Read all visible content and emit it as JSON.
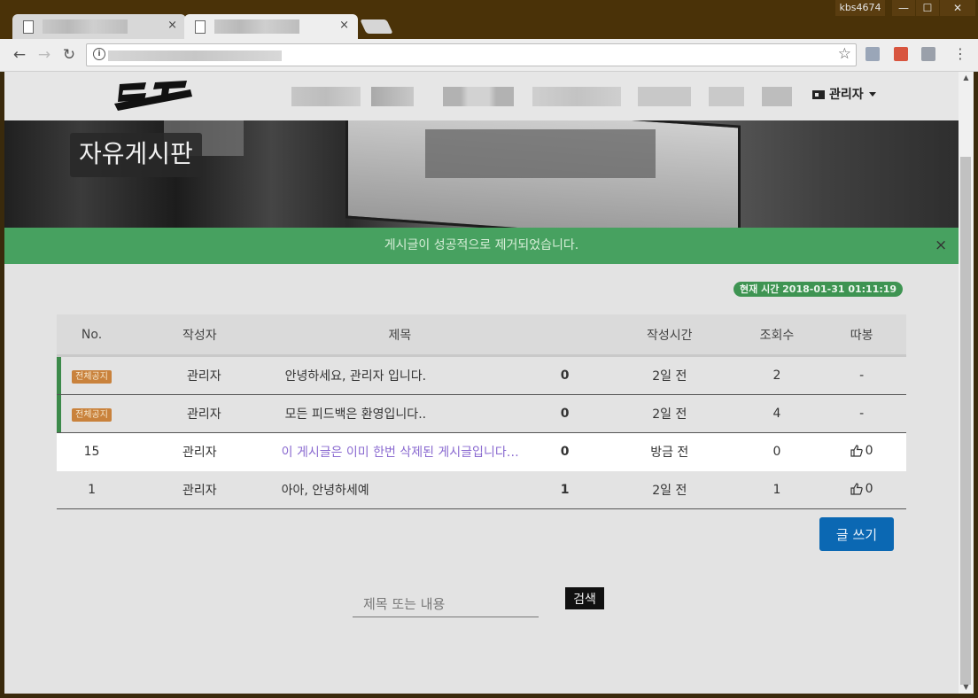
{
  "window": {
    "user": "kbs4674",
    "buttons": {
      "minimize": "—",
      "maximize": "☐",
      "close": "✕"
    }
  },
  "tabs": [
    {
      "close": "×"
    },
    {
      "close": "×"
    }
  ],
  "toolbar": {
    "back": "←",
    "forward": "→",
    "reload": "↻",
    "info": "i",
    "star": "☆",
    "menu": "⋮"
  },
  "header": {
    "logo_text": "로고",
    "admin_label": "관리자"
  },
  "hero": {
    "title": "자유게시판"
  },
  "alert": {
    "message": "게시글이 성공적으로 제거되었습니다.",
    "close": "×"
  },
  "clock": {
    "text": "현재 시간 2018-01-31 01:11:19"
  },
  "board": {
    "columns": [
      "No.",
      "작성자",
      "제목",
      "",
      "작성시간",
      "조회수",
      "따봉"
    ],
    "rows": [
      {
        "no": "전체공지",
        "author": "관리자",
        "title": "안녕하세요, 관리자 입니다.",
        "comments": "0",
        "time": "2일 전",
        "views": "2",
        "likes": "-"
      },
      {
        "no": "전체공지",
        "author": "관리자",
        "title": "모든 피드백은 환영입니다..",
        "comments": "0",
        "time": "2일 전",
        "views": "4",
        "likes": "-"
      },
      {
        "no": "15",
        "author": "관리자",
        "title": "이 게시글은 이미 한번 삭제된 게시글입니다…",
        "comments": "0",
        "time": "방금 전",
        "views": "0",
        "likes": "0"
      },
      {
        "no": "1",
        "author": "관리자",
        "title": "아아, 안녕하세예",
        "comments": "1",
        "time": "2일 전",
        "views": "1",
        "likes": "0"
      }
    ]
  },
  "write_button": "글 쓰기",
  "search": {
    "placeholder": "제목 또는 내용",
    "button": "검색"
  },
  "colors": {
    "alert": "#47a160",
    "notice_badge": "#c9823c",
    "write_button": "#0b68b3",
    "current_title": "#8a6ad0"
  }
}
